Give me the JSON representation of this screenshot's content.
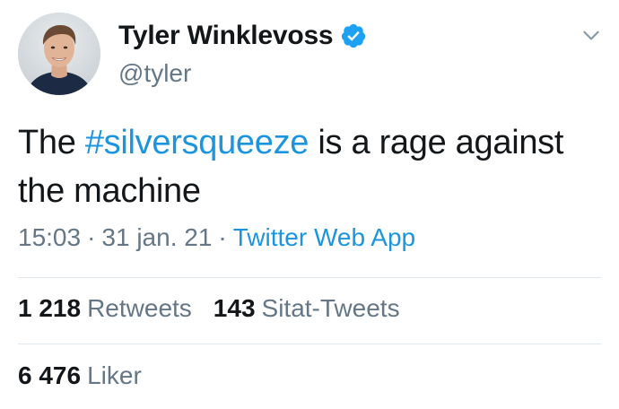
{
  "author": {
    "name": "Tyler Winklevoss",
    "handle": "@tyler",
    "verified": true,
    "avatar_icon": "profile-photo"
  },
  "tweet": {
    "text_before": "The ",
    "hashtag": "#silversqueeze",
    "text_after": " is a rage against the machine"
  },
  "meta": {
    "time": "15:03",
    "date": "31 jan. 21",
    "separator": "·",
    "source": "Twitter Web App"
  },
  "stats": {
    "retweets_count": "1 218",
    "retweets_label": "Retweets",
    "quotes_count": "143",
    "quotes_label": "Sitat-Tweets",
    "likes_count": "6 476",
    "likes_label": "Liker"
  },
  "colors": {
    "link_blue": "#1b95e0",
    "secondary_gray": "#657786",
    "divider": "#e1e8ed",
    "verified_badge": "#1da1f2"
  },
  "icons": {
    "verified": "verified-badge-icon",
    "menu": "chevron-down-icon"
  }
}
